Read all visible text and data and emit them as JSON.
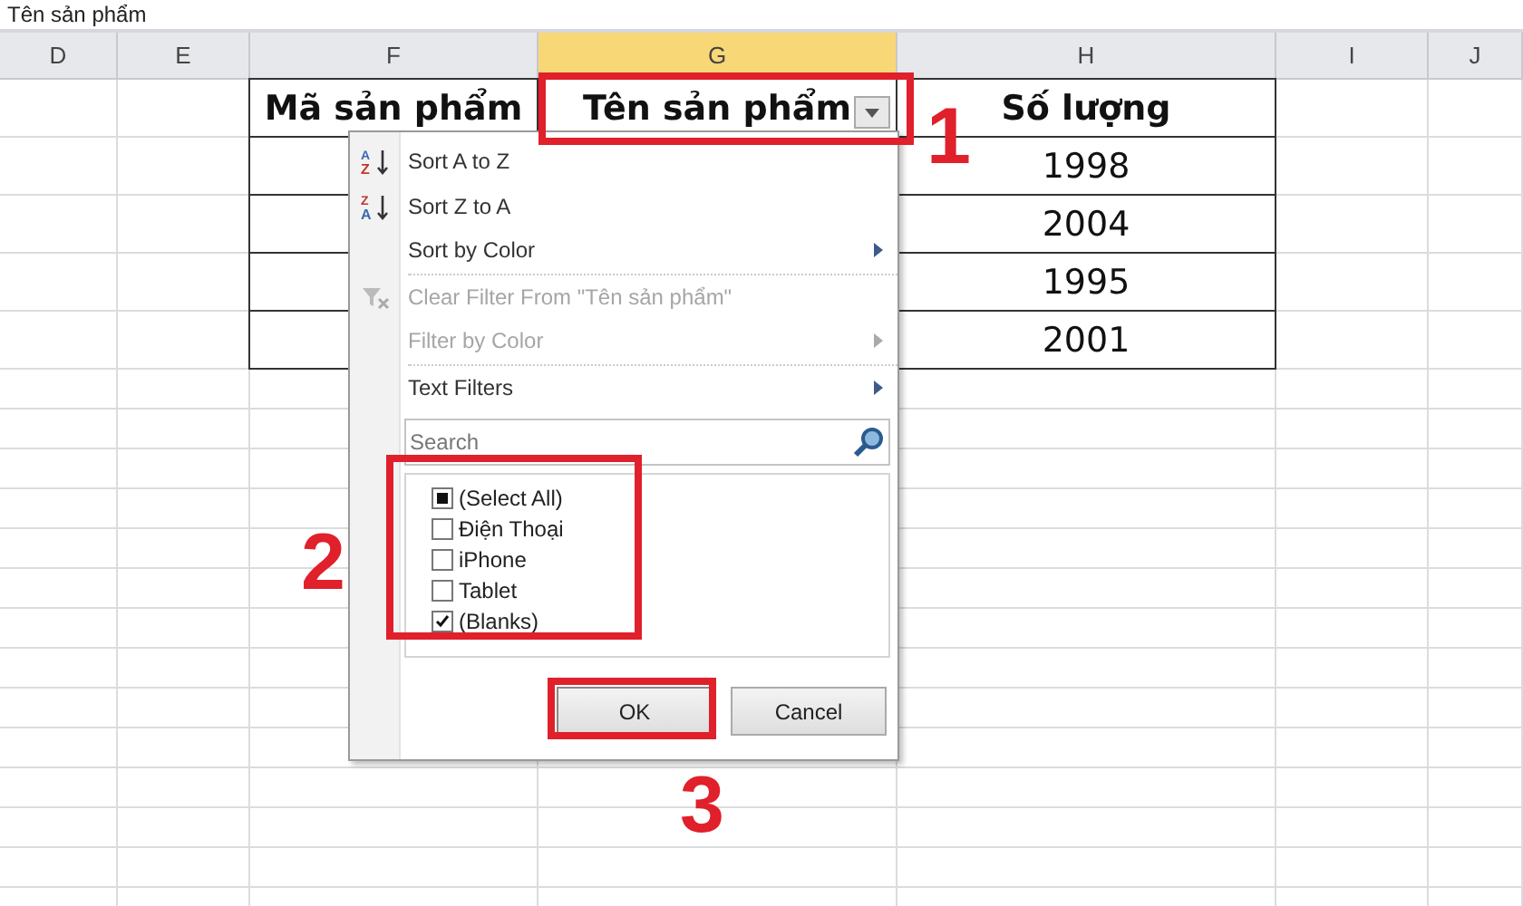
{
  "formula_bar": {
    "value": "Tên sản phẩm"
  },
  "columns": [
    {
      "label": "D",
      "selected": false
    },
    {
      "label": "E",
      "selected": false
    },
    {
      "label": "F",
      "selected": false
    },
    {
      "label": "G",
      "selected": true
    },
    {
      "label": "H",
      "selected": false
    },
    {
      "label": "I",
      "selected": false
    },
    {
      "label": "J",
      "selected": false
    }
  ],
  "table": {
    "headers": [
      {
        "text": "Mã sản phẩm",
        "filter": false
      },
      {
        "text": "Tên sản phẩm",
        "filter": true
      },
      {
        "text": "Số lượng",
        "filter": false
      }
    ],
    "rows": [
      {
        "quantity": "1998"
      },
      {
        "quantity": "2004"
      },
      {
        "quantity": "1995"
      },
      {
        "quantity": "2001"
      }
    ]
  },
  "filter_menu": {
    "items": [
      {
        "label": "Sort A to Z",
        "kind": "sort_asc",
        "icon_letters": [
          "A",
          "Z"
        ],
        "disabled": false,
        "submenu": false
      },
      {
        "label": "Sort Z to A",
        "kind": "sort_desc",
        "icon_letters": [
          "Z",
          "A"
        ],
        "disabled": false,
        "submenu": false
      },
      {
        "label": "Sort by Color",
        "kind": "plain",
        "disabled": false,
        "submenu": true
      },
      {
        "label": "Clear Filter From \"Tên sản phẩm\"",
        "kind": "clear_filter",
        "disabled": true,
        "submenu": false
      },
      {
        "label": "Filter by Color",
        "kind": "plain",
        "disabled": true,
        "submenu": true
      },
      {
        "label": "Text Filters",
        "kind": "plain",
        "disabled": false,
        "submenu": true
      }
    ],
    "search": {
      "placeholder": "Search"
    },
    "values": [
      {
        "label": "(Select All)",
        "checked": false,
        "mixed": true
      },
      {
        "label": "Điện Thoại",
        "checked": false,
        "mixed": false
      },
      {
        "label": "iPhone",
        "checked": false,
        "mixed": false
      },
      {
        "label": "Tablet",
        "checked": false,
        "mixed": false
      },
      {
        "label": "(Blanks)",
        "checked": true,
        "mixed": false
      }
    ],
    "buttons": [
      {
        "label": "OK",
        "kind": "primary"
      },
      {
        "label": "Cancel",
        "kind": "secondary"
      }
    ]
  },
  "annotations": [
    {
      "label": "1"
    },
    {
      "label": "2"
    },
    {
      "label": "3"
    }
  ]
}
